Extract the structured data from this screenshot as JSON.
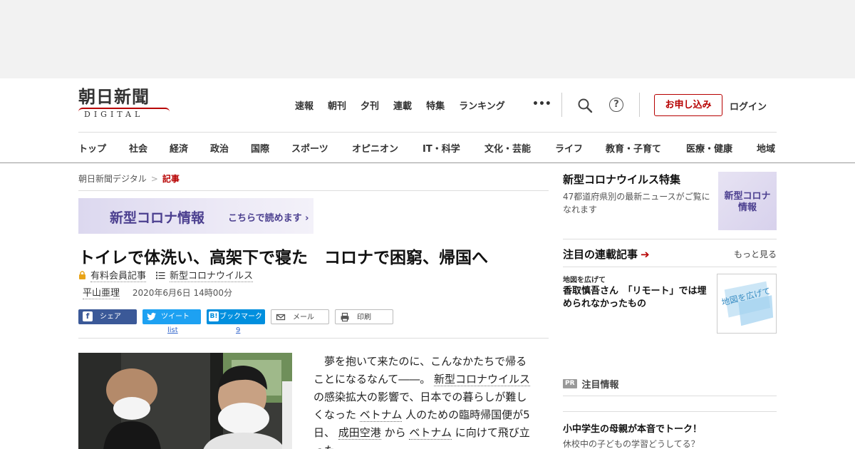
{
  "logo": {
    "kanji": "朝日新聞",
    "sub": "DIGITAL"
  },
  "top_nav": [
    "速報",
    "朝刊",
    "夕刊",
    "連載",
    "特集",
    "ランキング"
  ],
  "more_dots": "•••",
  "subscribe_label": "お申し込み",
  "login_label": "ログイン",
  "help_glyph": "?",
  "categories": [
    "トップ",
    "社会",
    "経済",
    "政治",
    "国際",
    "スポーツ",
    "オピニオン",
    "IT・科学",
    "文化・芸能",
    "ライフ",
    "教育・子育て",
    "医療・健康",
    "地域"
  ],
  "breadcrumb": {
    "home": "朝日新聞デジタル",
    "sep": ">",
    "current": "記事"
  },
  "banner": {
    "title": "新型コロナ情報",
    "sub": "こちらで読めます ›"
  },
  "article": {
    "headline": "トイレで体洗い、高架下で寝た　コロナで困窮、帰国へ",
    "premium_label": "有料会員記事",
    "topic_label": "新型コロナウイルス",
    "author": "平山亜理",
    "datetime": "2020年6月6日 14時00分",
    "body": {
      "p1": "夢を抱いて来たのに、こんなかたちで帰ることになるなんて――。",
      "kw1": "新型コロナウイルス",
      "p2": "の感染拡大の影響で、日本での暮らしが難しくなった",
      "kw2": "ベトナム",
      "p3": "人のための臨時帰国便が5日、",
      "kw3": "成田空港",
      "p4": "から",
      "kw4": "ベトナム",
      "p5": "に向けて飛び立った。"
    }
  },
  "share": {
    "facebook": "シェア",
    "twitter": "ツイート",
    "twitter_count": "list",
    "hatena": "ブックマーク",
    "hatena_count": "9",
    "mail": "メール",
    "print": "印刷"
  },
  "sidebar": {
    "feature_title": "新型コロナウイルス特集",
    "feature_desc": "47都道府県別の最新ニュースがご覧になれます",
    "feature_thumb": "新型コロナ\n情報",
    "serial_title": "注目の連載記事",
    "serial_arrow": "➔",
    "more_link": "もっと見る",
    "serial_category": "地図を広げて",
    "serial_headline": "香取慎吾さん　「リモート」では埋められなかったもの",
    "serial_thumb_text": "地図を広げて",
    "pr_badge": "PR",
    "pr_label": "注目情報",
    "pr_headline": "小中学生の母親が本音でトーク！",
    "pr_sub": "休校中の子どもの学習どうしてる？"
  },
  "colors": {
    "brand_red": "#b70000",
    "facebook": "#3b5998",
    "twitter": "#1da1f2",
    "hatena": "#008fde",
    "corona_purple": "#4b3f8f"
  }
}
